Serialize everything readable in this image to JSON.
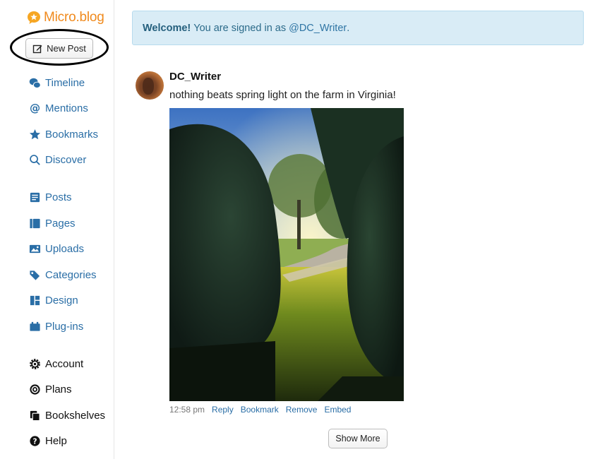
{
  "brand": {
    "name": "Micro.blog"
  },
  "toolbar": {
    "new_post_label": "New Post"
  },
  "nav": {
    "timeline": "Timeline",
    "mentions": "Mentions",
    "bookmarks": "Bookmarks",
    "discover": "Discover",
    "posts": "Posts",
    "pages": "Pages",
    "uploads": "Uploads",
    "categories": "Categories",
    "design": "Design",
    "plugins": "Plug-ins",
    "account": "Account",
    "plans": "Plans",
    "bookshelves": "Bookshelves",
    "help": "Help"
  },
  "banner": {
    "welcome": "Welcome!",
    "message": "You are signed in as",
    "handle": "@DC_Writer",
    "end": "."
  },
  "post": {
    "author": "DC_Writer",
    "text": "nothing beats spring light on the farm in Virginia!",
    "time": "12:58 pm",
    "actions": {
      "reply": "Reply",
      "bookmark": "Bookmark",
      "remove": "Remove",
      "embed": "Embed"
    }
  },
  "feed": {
    "show_more_label": "Show More"
  },
  "colors": {
    "brand_orange": "#f08a1d",
    "link_blue": "#2a6ea6",
    "banner_bg": "#d9ecf6"
  }
}
